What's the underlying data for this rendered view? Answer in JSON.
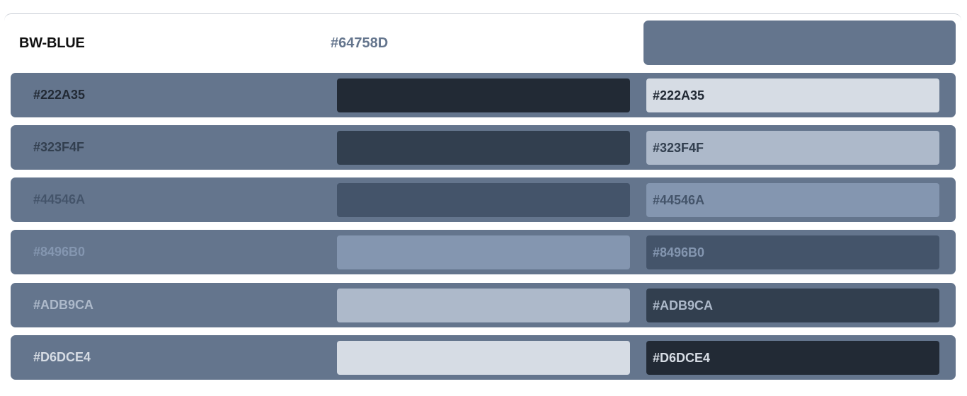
{
  "palette": {
    "name": "BW-BLUE",
    "base_hex": "#64758D",
    "base_color": "#64758D"
  },
  "shades": [
    {
      "hex": "#222A35",
      "label_color": "#222A35",
      "swatch_color": "#222A35",
      "chip_bg": "#D6DCE4",
      "chip_text": "#222A35"
    },
    {
      "hex": "#323F4F",
      "label_color": "#323F4F",
      "swatch_color": "#323F4F",
      "chip_bg": "#ADB9CA",
      "chip_text": "#323F4F"
    },
    {
      "hex": "#44546A",
      "label_color": "#44546A",
      "swatch_color": "#44546A",
      "chip_bg": "#8496B0",
      "chip_text": "#44546A"
    },
    {
      "hex": "#8496B0",
      "label_color": "#8496B0",
      "swatch_color": "#8496B0",
      "chip_bg": "#44546A",
      "chip_text": "#8496B0"
    },
    {
      "hex": "#ADB9CA",
      "label_color": "#ADB9CA",
      "swatch_color": "#ADB9CA",
      "chip_bg": "#323F4F",
      "chip_text": "#ADB9CA"
    },
    {
      "hex": "#D6DCE4",
      "label_color": "#D6DCE4",
      "swatch_color": "#D6DCE4",
      "chip_bg": "#222A35",
      "chip_text": "#D6DCE4"
    }
  ]
}
